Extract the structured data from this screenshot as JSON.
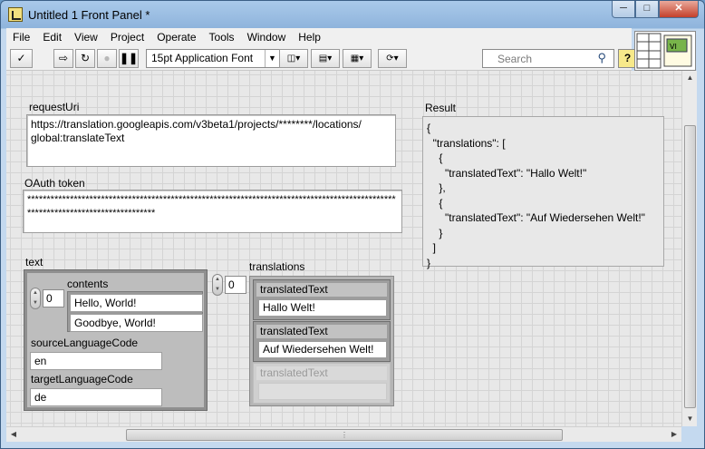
{
  "window": {
    "title": "Untitled 1 Front Panel *"
  },
  "menu": [
    "File",
    "Edit",
    "View",
    "Project",
    "Operate",
    "Tools",
    "Window",
    "Help"
  ],
  "toolbar": {
    "font_selector": "15pt Application Font",
    "search_placeholder": "Search",
    "help_label": "?"
  },
  "request_uri": {
    "label": "requestUri",
    "value": "https://translation.googleapis.com/v3beta1/projects/********/locations/\nglobal:translateText"
  },
  "oauth": {
    "label": "OAuth token",
    "value": "********************************************************************************************************************************"
  },
  "text_cluster": {
    "label": "text",
    "contents_label": "contents",
    "contents_index": "0",
    "contents": [
      "Hello, World!",
      "Goodbye, World!"
    ],
    "source_label": "sourceLanguageCode",
    "source_value": "en",
    "target_label": "targetLanguageCode",
    "target_value": "de"
  },
  "translations": {
    "label": "translations",
    "index": "0",
    "field_label": "translatedText",
    "items": [
      "Hallo Welt!",
      "Auf Wiedersehen Welt!",
      ""
    ]
  },
  "result": {
    "label": "Result",
    "value": "{\n  \"translations\": [\n    {\n      \"translatedText\": \"Hallo Welt!\"\n    },\n    {\n      \"translatedText\": \"Auf Wiedersehen Welt!\"\n    }\n  ]\n}"
  }
}
